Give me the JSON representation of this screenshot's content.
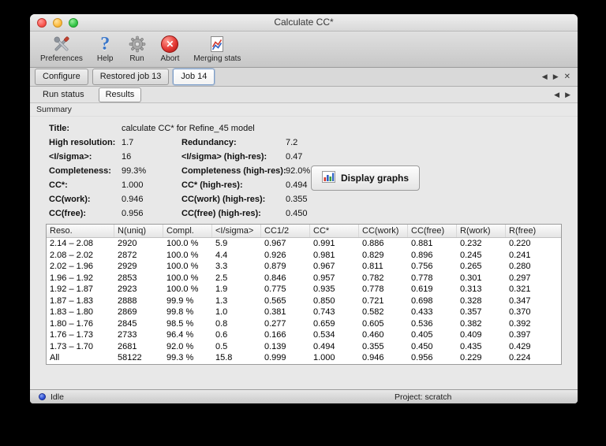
{
  "window": {
    "title": "Calculate CC*"
  },
  "toolbar": {
    "items": [
      {
        "label": "Preferences",
        "icon": "preferences-tools-icon"
      },
      {
        "label": "Help",
        "icon": "help-question-icon"
      },
      {
        "label": "Run",
        "icon": "run-gear-icon"
      },
      {
        "label": "Abort",
        "icon": "abort-icon"
      },
      {
        "label": "Merging stats",
        "icon": "merging-stats-icon"
      }
    ]
  },
  "tabs": {
    "main": [
      {
        "label": "Configure",
        "active": false
      },
      {
        "label": "Restored job 13",
        "active": false
      },
      {
        "label": "Job 14",
        "active": true
      }
    ],
    "sub": [
      {
        "label": "Run status",
        "active": false
      },
      {
        "label": "Results",
        "active": true
      }
    ],
    "nav": {
      "left": "◀",
      "right": "▶",
      "close": "✕"
    },
    "section_label": "Summary"
  },
  "summary": {
    "title_label": "Title:",
    "title_value": "calculate CC* for Refine_45 model",
    "rows": [
      {
        "l1": "High resolution:",
        "v1": "1.7",
        "l2": "Redundancy:",
        "v2": "7.2"
      },
      {
        "l1": "<I/sigma>:",
        "v1": "16",
        "l2": "<I/sigma> (high-res):",
        "v2": "0.47"
      },
      {
        "l1": "Completeness:",
        "v1": "99.3%",
        "l2": "Completeness (high-res):",
        "v2": "92.0%"
      },
      {
        "l1": "CC*:",
        "v1": "1.000",
        "l2": "CC* (high-res):",
        "v2": "0.494"
      },
      {
        "l1": "CC(work):",
        "v1": "0.946",
        "l2": "CC(work) (high-res):",
        "v2": "0.355"
      },
      {
        "l1": "CC(free):",
        "v1": "0.956",
        "l2": "CC(free) (high-res):",
        "v2": "0.450"
      }
    ],
    "display_graphs_label": "Display graphs"
  },
  "table": {
    "columns": [
      "Reso.",
      "N(uniq)",
      "Compl.",
      "<I/sigma>",
      "CC1/2",
      "CC*",
      "CC(work)",
      "CC(free)",
      "R(work)",
      "R(free)"
    ],
    "rows": [
      [
        "2.14 – 2.08",
        "2920",
        "100.0 %",
        "5.9",
        "0.967",
        "0.991",
        "0.886",
        "0.881",
        "0.232",
        "0.220"
      ],
      [
        "2.08 – 2.02",
        "2872",
        "100.0 %",
        "4.4",
        "0.926",
        "0.981",
        "0.829",
        "0.896",
        "0.245",
        "0.241"
      ],
      [
        "2.02 – 1.96",
        "2929",
        "100.0 %",
        "3.3",
        "0.879",
        "0.967",
        "0.811",
        "0.756",
        "0.265",
        "0.280"
      ],
      [
        "1.96 – 1.92",
        "2853",
        "100.0 %",
        "2.5",
        "0.846",
        "0.957",
        "0.782",
        "0.778",
        "0.301",
        "0.297"
      ],
      [
        "1.92 – 1.87",
        "2923",
        "100.0 %",
        "1.9",
        "0.775",
        "0.935",
        "0.778",
        "0.619",
        "0.313",
        "0.321"
      ],
      [
        "1.87 – 1.83",
        "2888",
        "99.9 %",
        "1.3",
        "0.565",
        "0.850",
        "0.721",
        "0.698",
        "0.328",
        "0.347"
      ],
      [
        "1.83 – 1.80",
        "2869",
        "99.8 %",
        "1.0",
        "0.381",
        "0.743",
        "0.582",
        "0.433",
        "0.357",
        "0.370"
      ],
      [
        "1.80 – 1.76",
        "2845",
        "98.5 %",
        "0.8",
        "0.277",
        "0.659",
        "0.605",
        "0.536",
        "0.382",
        "0.392"
      ],
      [
        "1.76 – 1.73",
        "2733",
        "96.4 %",
        "0.6",
        "0.166",
        "0.534",
        "0.460",
        "0.405",
        "0.409",
        "0.397"
      ],
      [
        "1.73 – 1.70",
        "2681",
        "92.0 %",
        "0.5",
        "0.139",
        "0.494",
        "0.355",
        "0.450",
        "0.435",
        "0.429"
      ],
      [
        "All",
        "58122",
        "99.3 %",
        "15.8",
        "0.999",
        "1.000",
        "0.946",
        "0.956",
        "0.229",
        "0.224"
      ]
    ]
  },
  "statusbar": {
    "status": "Idle",
    "project": "Project: scratch"
  },
  "colors": {
    "abort_red": "#e53935",
    "help_blue": "#3b77c9",
    "status_dot_blue": "#2c4fd8",
    "chart_blue": "#2f62c4",
    "chart_red": "#d23b2f",
    "chart_green": "#3f9e3f",
    "active_tab_outline": "#7d9ec9"
  }
}
